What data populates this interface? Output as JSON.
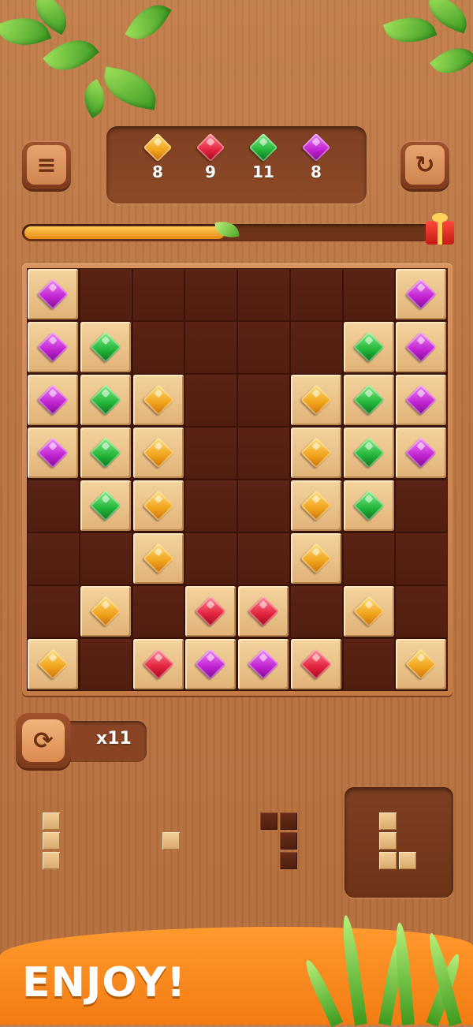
{
  "goals": [
    {
      "gem": "yellow",
      "count": "8"
    },
    {
      "gem": "red",
      "count": "9"
    },
    {
      "gem": "green",
      "count": "11"
    },
    {
      "gem": "purple",
      "count": "8"
    }
  ],
  "progress": 0.5,
  "board": {
    "rows": [
      [
        "purple",
        "",
        "",
        "",
        "",
        "",
        "",
        "purple"
      ],
      [
        "purple",
        "green",
        "",
        "",
        "",
        "",
        "green",
        "purple"
      ],
      [
        "purple",
        "green",
        "yellow",
        "",
        "",
        "yellow",
        "green",
        "purple"
      ],
      [
        "purple",
        "green",
        "yellow",
        "",
        "",
        "yellow",
        "green",
        "purple"
      ],
      [
        "",
        "green",
        "yellow",
        "",
        "",
        "yellow",
        "green",
        ""
      ],
      [
        "",
        "",
        "yellow",
        "",
        "",
        "yellow",
        "",
        ""
      ],
      [
        "",
        "yellow",
        "",
        "red",
        "red",
        "",
        "yellow",
        ""
      ],
      [
        "yellow",
        "",
        "red",
        "purple",
        "purple",
        "red",
        "",
        "yellow"
      ]
    ]
  },
  "swap": {
    "count": "x11"
  },
  "icons": {
    "menu": "menu-icon",
    "restart": "restart-icon",
    "swap": "swap-icon",
    "gift": "gift-icon"
  },
  "banner": {
    "text": "ENJOY!"
  },
  "colors": {
    "yellow": "#f0a21a",
    "red": "#e2223c",
    "green": "#21b437",
    "purple": "#c021d0",
    "banner": "#f27c12"
  }
}
